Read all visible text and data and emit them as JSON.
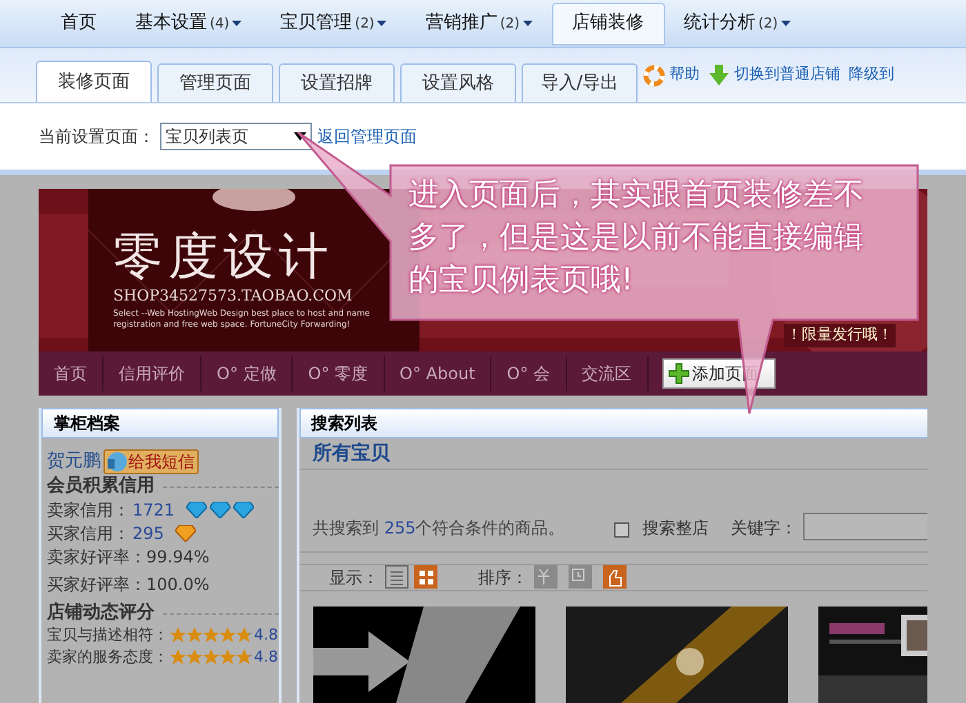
{
  "top_nav": [
    {
      "label": "首页",
      "dropdown": false,
      "selected": false
    },
    {
      "label": "基本设置",
      "badge": "(4)",
      "dropdown": true,
      "selected": false
    },
    {
      "label": "宝贝管理",
      "badge": "(2)",
      "dropdown": true,
      "selected": false
    },
    {
      "label": "营销推广",
      "badge": "(2)",
      "dropdown": true,
      "selected": false
    },
    {
      "label": "店铺装修",
      "dropdown": false,
      "selected": true
    },
    {
      "label": "统计分析",
      "badge": "(2)",
      "dropdown": true,
      "selected": false
    }
  ],
  "tabs": [
    {
      "label": "装修页面",
      "selected": true
    },
    {
      "label": "管理页面",
      "selected": false
    },
    {
      "label": "设置招牌",
      "selected": false
    },
    {
      "label": "设置风格",
      "selected": false
    },
    {
      "label": "导入/导出",
      "selected": false
    }
  ],
  "tool_links": [
    {
      "kind": "help",
      "label": "帮助"
    },
    {
      "kind": "switch",
      "label": "切换到普通店铺"
    },
    {
      "kind": "plain",
      "label": "降级到"
    }
  ],
  "page_select": {
    "label": "当前设置页面：",
    "value": "宝贝列表页",
    "link": "返回管理页面"
  },
  "banner": {
    "logo": "零度设计",
    "url": "SHOP34527573.TAOBAO.COM",
    "tagline": "Select --Web HostingWeb Design  best place to host and name registration and free web space. FortuneCity Forwarding!",
    "promo": "！限量发行哦！"
  },
  "shop_nav": {
    "items": [
      "首页",
      "信用评价",
      "O° 定做",
      "O° 零度",
      "O° About",
      "O° 会",
      "交流区"
    ],
    "add_button": "添加页面"
  },
  "callout": "进入页面后，其实跟首页装修差不多了，但是这是以前不能直接编辑的宝贝例表页哦!",
  "profile": {
    "title": "掌柜档案",
    "name": "贺元鹏",
    "message_badge": "给我短信",
    "credit_heading": "会员积累信用",
    "credits": [
      {
        "label": "卖家信用：",
        "value": "1721",
        "rank": [
          {
            "kind": "diamond"
          },
          {
            "kind": "diamond"
          },
          {
            "kind": "diamond"
          }
        ]
      },
      {
        "label": "买家信用：",
        "value": "295",
        "rank": [
          {
            "kind": "gold_diamond"
          }
        ]
      }
    ],
    "rates": [
      {
        "label": "卖家好评率：",
        "value": "99.94%"
      },
      {
        "label": "买家好评率：",
        "value": "100.0%"
      }
    ],
    "score_heading": "店铺动态评分",
    "scores": [
      {
        "label": "宝贝与描述相符：",
        "stars": 4.8,
        "value": "4.8"
      },
      {
        "label": "卖家的服务态度：",
        "stars": 4.8,
        "value": "4.8"
      }
    ]
  },
  "search_list": {
    "title": "搜索列表",
    "breadcrumb": "所有宝贝",
    "result_prefix": "共搜索到",
    "result_count": "255",
    "result_suffix": "个符合条件的商品。",
    "whole_shop": {
      "label": "搜索整店",
      "checked": false
    },
    "keyword_label": "关键字：",
    "display_label": "显示：",
    "views": [
      {
        "kind": "list",
        "selected": false
      },
      {
        "kind": "grid",
        "selected": true
      }
    ],
    "sort_label": "排序：",
    "sorts": [
      {
        "kind": "price",
        "selected": false
      },
      {
        "kind": "time",
        "selected": false
      },
      {
        "kind": "popular",
        "selected": true
      }
    ]
  }
}
